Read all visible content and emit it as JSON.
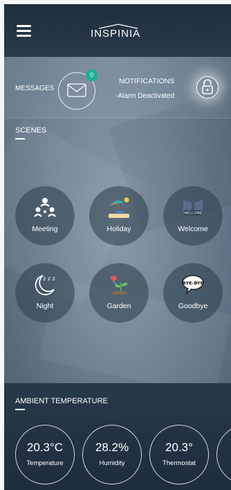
{
  "header": {
    "logo_text": "INSPINIA"
  },
  "status": {
    "messages_label": "MESSAGES",
    "messages_count": "0",
    "notifications_title": "NOTIFICATIONS",
    "notifications_text": "-Alarm Deactivated"
  },
  "scenes": {
    "title": "SCENES",
    "items": [
      {
        "label": "Meeting",
        "icon": "meeting-icon"
      },
      {
        "label": "Holiday",
        "icon": "holiday-icon"
      },
      {
        "label": "Welcome",
        "icon": "welcome-icon",
        "icon_text": "WELCOME"
      },
      {
        "label": "Night",
        "icon": "night-icon",
        "icon_text": "z z z"
      },
      {
        "label": "Garden",
        "icon": "garden-icon"
      },
      {
        "label": "Goodbye",
        "icon": "goodbye-icon",
        "icon_text": "BYE-BYE"
      }
    ]
  },
  "ambient": {
    "title": "AMBIENT TEMPERATURE",
    "items": [
      {
        "value": "20.3°C",
        "label": "Temperature"
      },
      {
        "value": "28.2%",
        "label": "Humidity"
      },
      {
        "value": "20.3°",
        "label": "Thermostat"
      }
    ]
  },
  "colors": {
    "accent": "#1ab394",
    "header_bg": "#1f2e3c",
    "ambient_bg": "#283949"
  }
}
